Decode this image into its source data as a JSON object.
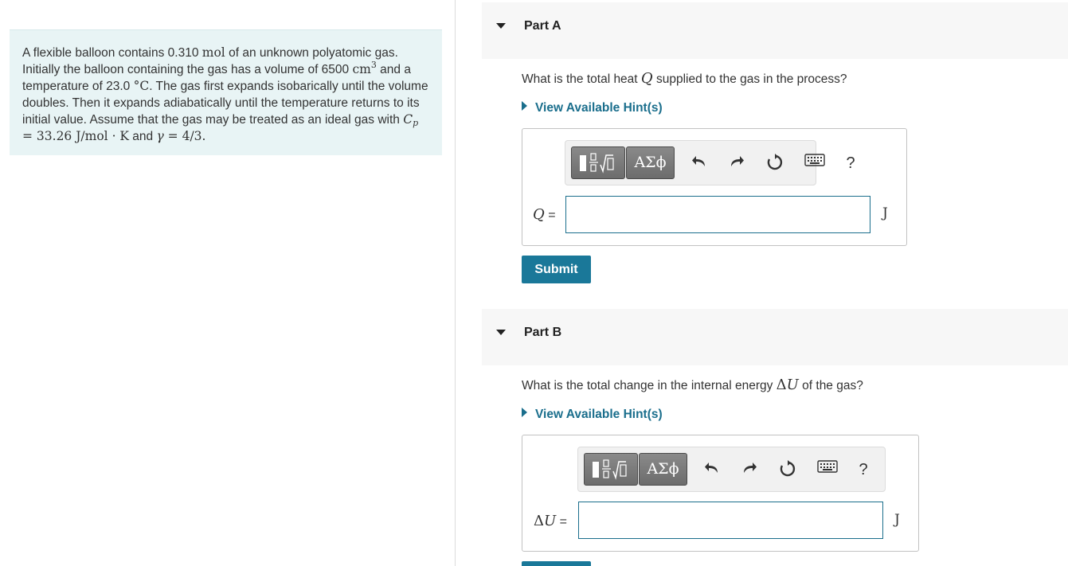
{
  "problem": {
    "t1": "A flexible balloon contains 0.310 ",
    "mol": "mol",
    "t2": " of an unknown polyatomic gas. Initially the balloon containing the gas has a volume of 6500 ",
    "cm": "cm",
    "cm_exp": "3",
    "t3": " and a temperature of 23.0 ",
    "degC": "°C",
    "t4": ". The gas first expands isobarically until the volume doubles. Then it expands adiabatically until the temperature returns to its initial value. Assume that the gas may be treated as an ideal gas with ",
    "cp_sym": "C",
    "cp_sub": "p",
    "cp_val": " = 33.26 J/mol · K",
    "t5": " and ",
    "gamma": "γ",
    "gamma_val": " = 4/3",
    "t6": "."
  },
  "partA": {
    "title": "Part A",
    "q1": "What is the total heat ",
    "qvar": "Q",
    "q2": " supplied to the gas in the process?",
    "hint": "View Available Hint(s)",
    "greek": "ΑΣϕ",
    "help": "?",
    "var": "Q",
    "eq": " =",
    "value": "",
    "unit": "J",
    "submit": "Submit"
  },
  "partB": {
    "title": "Part B",
    "q1": "What is the total change in the internal energy ",
    "qvar_delta": "Δ",
    "qvar": "U",
    "q2": " of the gas?",
    "hint": "View Available Hint(s)",
    "greek": "ΑΣϕ",
    "help": "?",
    "var_delta": "Δ",
    "var": "U",
    "eq": " =",
    "value": "",
    "unit": "J"
  }
}
